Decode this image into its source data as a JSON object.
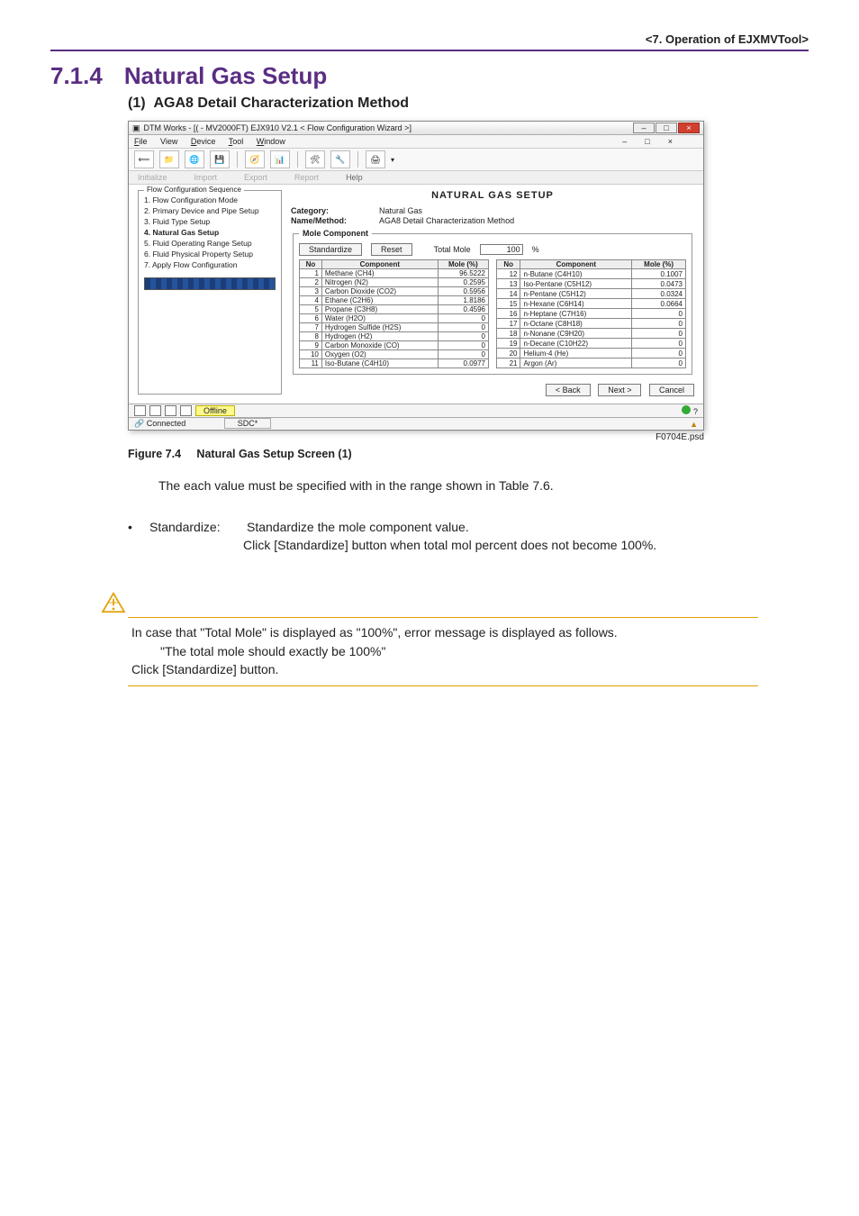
{
  "header": {
    "chapter_label": "<7.  Operation of EJXMVTool>"
  },
  "section": {
    "number": "7.1.4",
    "title": "Natural Gas Setup",
    "sub_number": "(1)",
    "sub_title": "AGA8 Detail Characterization Method"
  },
  "window": {
    "title": "DTM Works - [( - MV2000FT) EJX910 V2.1 < Flow Configuration Wizard >]",
    "menus": [
      "File",
      "View",
      "Device",
      "Tool",
      "Window"
    ],
    "win_btns": {
      "min": "–",
      "max": "□",
      "close": "×"
    },
    "subtoolbar": {
      "initialize": "Initialize",
      "import": "Import",
      "export": "Export",
      "report": "Report",
      "help": "Help"
    },
    "sequence": {
      "legend": "Flow Configuration Sequence",
      "items": [
        "1. Flow Configuration Mode",
        "2. Primary Device and Pipe Setup",
        "3. Fluid Type Setup",
        "4. Natural Gas Setup",
        "5. Fluid Operating Range Setup",
        "6. Fluid Physical Property Setup",
        "7. Apply Flow Configuration"
      ],
      "bold_index": 3
    },
    "panel_title": "NATURAL GAS SETUP",
    "meta": {
      "category_label": "Category:",
      "category_value": "Natural Gas",
      "method_label": "Name/Method:",
      "method_value": "AGA8 Detail Characterization Method"
    },
    "mole": {
      "legend": "Mole Component",
      "standardize_btn": "Standardize",
      "reset_btn": "Reset",
      "total_label": "Total Mole",
      "total_value": "100",
      "percent": "%",
      "headers": {
        "no": "No",
        "component": "Component",
        "mole": "Mole (%)"
      },
      "left": [
        {
          "no": 1,
          "name": "Methane (CH4)",
          "pct": "96.5222"
        },
        {
          "no": 2,
          "name": "Nitrogen (N2)",
          "pct": "0.2595"
        },
        {
          "no": 3,
          "name": "Carbon Dioxide (CO2)",
          "pct": "0.5956"
        },
        {
          "no": 4,
          "name": "Ethane (C2H6)",
          "pct": "1.8186"
        },
        {
          "no": 5,
          "name": "Propane (C3H8)",
          "pct": "0.4596"
        },
        {
          "no": 6,
          "name": "Water (H2O)",
          "pct": "0"
        },
        {
          "no": 7,
          "name": "Hydrogen Sulfide (H2S)",
          "pct": "0"
        },
        {
          "no": 8,
          "name": "Hydrogen (H2)",
          "pct": "0"
        },
        {
          "no": 9,
          "name": "Carbon Monoxide (CO)",
          "pct": "0"
        },
        {
          "no": 10,
          "name": "Oxygen (O2)",
          "pct": "0"
        },
        {
          "no": 11,
          "name": "Iso-Butane (C4H10)",
          "pct": "0.0977"
        }
      ],
      "right": [
        {
          "no": 12,
          "name": "n-Butane (C4H10)",
          "pct": "0.1007"
        },
        {
          "no": 13,
          "name": "Iso-Pentane (C5H12)",
          "pct": "0.0473"
        },
        {
          "no": 14,
          "name": "n-Pentane (C5H12)",
          "pct": "0.0324"
        },
        {
          "no": 15,
          "name": "n-Hexane (C6H14)",
          "pct": "0.0664"
        },
        {
          "no": 16,
          "name": "n-Heptane (C7H16)",
          "pct": "0"
        },
        {
          "no": 17,
          "name": "n-Octane (C8H18)",
          "pct": "0"
        },
        {
          "no": 18,
          "name": "n-Nonane (C9H20)",
          "pct": "0"
        },
        {
          "no": 19,
          "name": "n-Decane (C10H22)",
          "pct": "0"
        },
        {
          "no": 20,
          "name": "Helium-4 (He)",
          "pct": "0"
        },
        {
          "no": 21,
          "name": "Argon (Ar)",
          "pct": "0"
        }
      ]
    },
    "wizard": {
      "back": "< Back",
      "next": "Next >",
      "cancel": "Cancel"
    },
    "status": {
      "offline": "Offline",
      "connected": "Connected",
      "user": "SDC*",
      "help": "?"
    }
  },
  "figure": {
    "caption_prefix": "Figure 7.4",
    "caption_text": "Natural Gas Setup Screen (1)",
    "code": "F0704E.psd"
  },
  "body": {
    "range_note": "The each value must be specified with in the range shown in Table 7.6.",
    "bullet": {
      "dot": "•",
      "label": "Standardize:",
      "desc": "Standardize the mole component value."
    },
    "bullet_more": "Click [Standardize] button when total mol percent does not become 100%."
  },
  "note": {
    "line1": "In case that \"Total Mole\" is displayed as \"100%\", error message is displayed as follows.",
    "line2": "\"The total mole should exactly be 100%\"",
    "line3": "Click [Standardize] button."
  }
}
